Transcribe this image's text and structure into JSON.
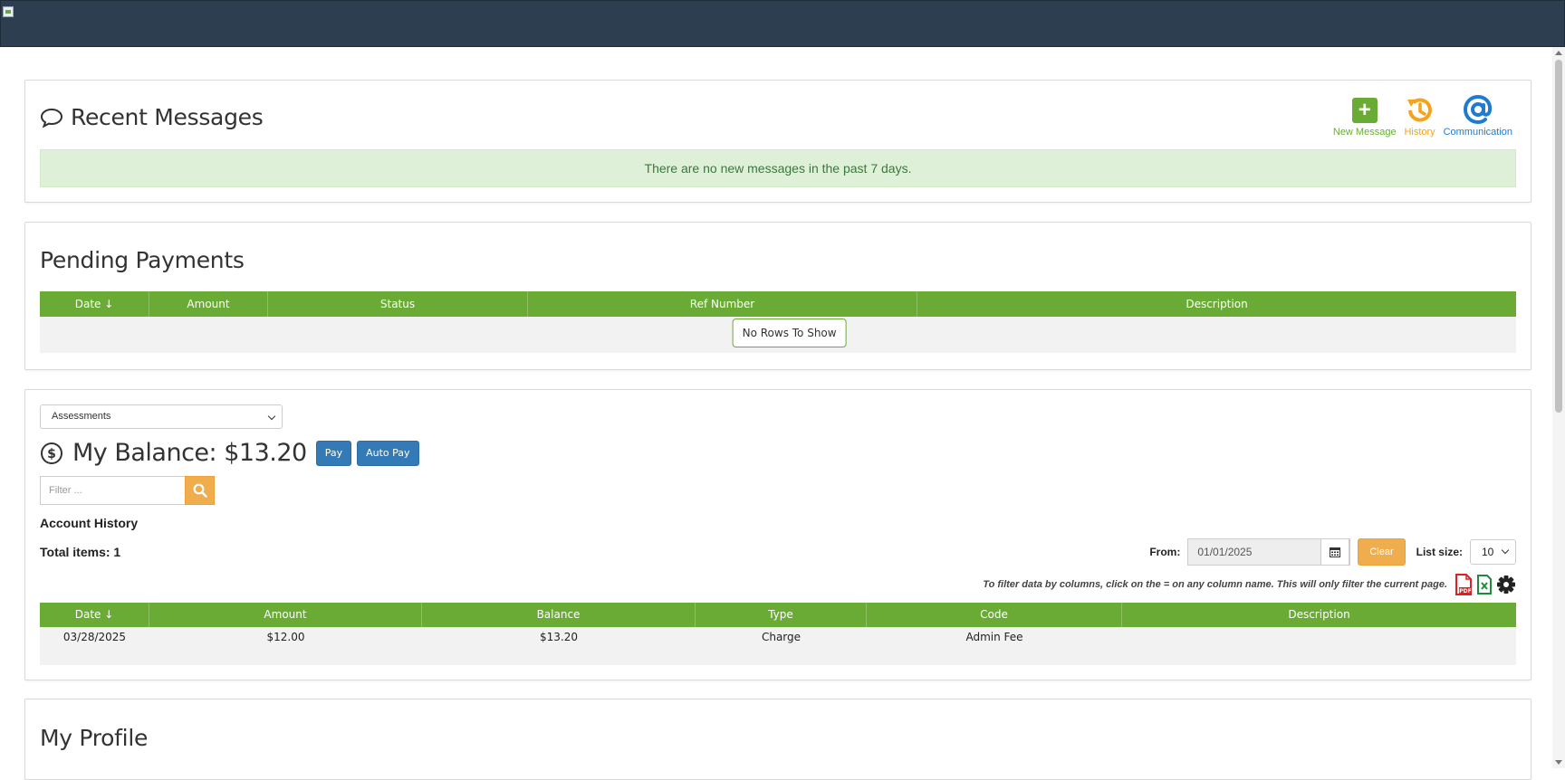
{
  "recent_messages": {
    "title": "Recent Messages",
    "actions": {
      "new_message": "New Message",
      "history": "History",
      "communication": "Communication"
    },
    "alert": "There are no new messages in the past 7 days."
  },
  "pending_payments": {
    "title": "Pending Payments",
    "columns": [
      "Date ↓",
      "Amount",
      "Status",
      "Ref Number",
      "Description"
    ],
    "empty_text": "No Rows To Show"
  },
  "balance": {
    "select_value": "Assessments",
    "title": "My Balance: $13.20",
    "pay_label": "Pay",
    "autopay_label": "Auto Pay",
    "filter_placeholder": "Filter ...",
    "account_history": "Account History",
    "total_items": "Total items: 1",
    "from_label": "From:",
    "from_value": "01/01/2025",
    "clear_label": "Clear",
    "list_size_label": "List size:",
    "list_size_value": "10",
    "hint": "To filter data by columns, click on the = on any column name. This will only filter the current page.",
    "columns": [
      "Date ↓",
      "Amount",
      "Balance",
      "Type",
      "Code",
      "Description"
    ],
    "rows": [
      {
        "date": "03/28/2025",
        "amount": "$12.00",
        "balance": "$13.20",
        "type": "Charge",
        "code": "Admin Fee",
        "description": ""
      }
    ]
  },
  "profile": {
    "title": "My Profile"
  },
  "colors": {
    "header_bg": "#2c3e50",
    "grid_green": "#6aab35",
    "history_orange": "#f5a31a",
    "communication_blue": "#1e7bd0"
  }
}
